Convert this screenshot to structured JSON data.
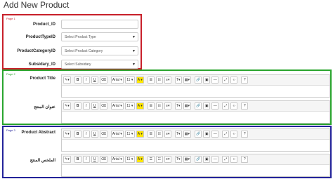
{
  "page_title": "Add New Product",
  "pages": [
    {
      "label": "Page 1"
    },
    {
      "label": "Page 2"
    },
    {
      "label": "Page 3"
    }
  ],
  "form": {
    "product_id_label": "Product_ID",
    "product_type_label": "ProductTypeID",
    "product_type_value": "Select Product Type",
    "category_label": "ProductCategoryID",
    "category_value": "Select Product Category",
    "subsidiary_label": "Subsidary_ID",
    "subsidiary_value": "Select Subsidary",
    "product_title_label": "Product Title",
    "product_title_ar_label": "عنوان المنتج",
    "product_abstract_label": "Product Abstract",
    "product_abstract_ar_label": "الملخص المنتج"
  },
  "toolbar": {
    "pen": "✎▾",
    "bold": "B",
    "italic": "I",
    "underline": "U",
    "eraser": "⌫",
    "font": "Arial ▾",
    "size": "11 ▾",
    "color": "A ▾",
    "ul": "☰",
    "ol": "☷",
    "align": "≡▾",
    "line_height": "T▾",
    "table": "▦▾",
    "link": "🔗",
    "image": "▣",
    "hr": "—",
    "fullscreen": "⤢",
    "code": "‹›",
    "help": "?"
  },
  "icons": [
    "pen-icon",
    "eraser-icon",
    "unordered-list-icon",
    "ordered-list-icon",
    "align-icon",
    "line-height-icon",
    "table-icon",
    "link-icon",
    "image-icon",
    "horizontal-rule-icon",
    "fullscreen-icon",
    "code-view-icon",
    "help-icon"
  ]
}
